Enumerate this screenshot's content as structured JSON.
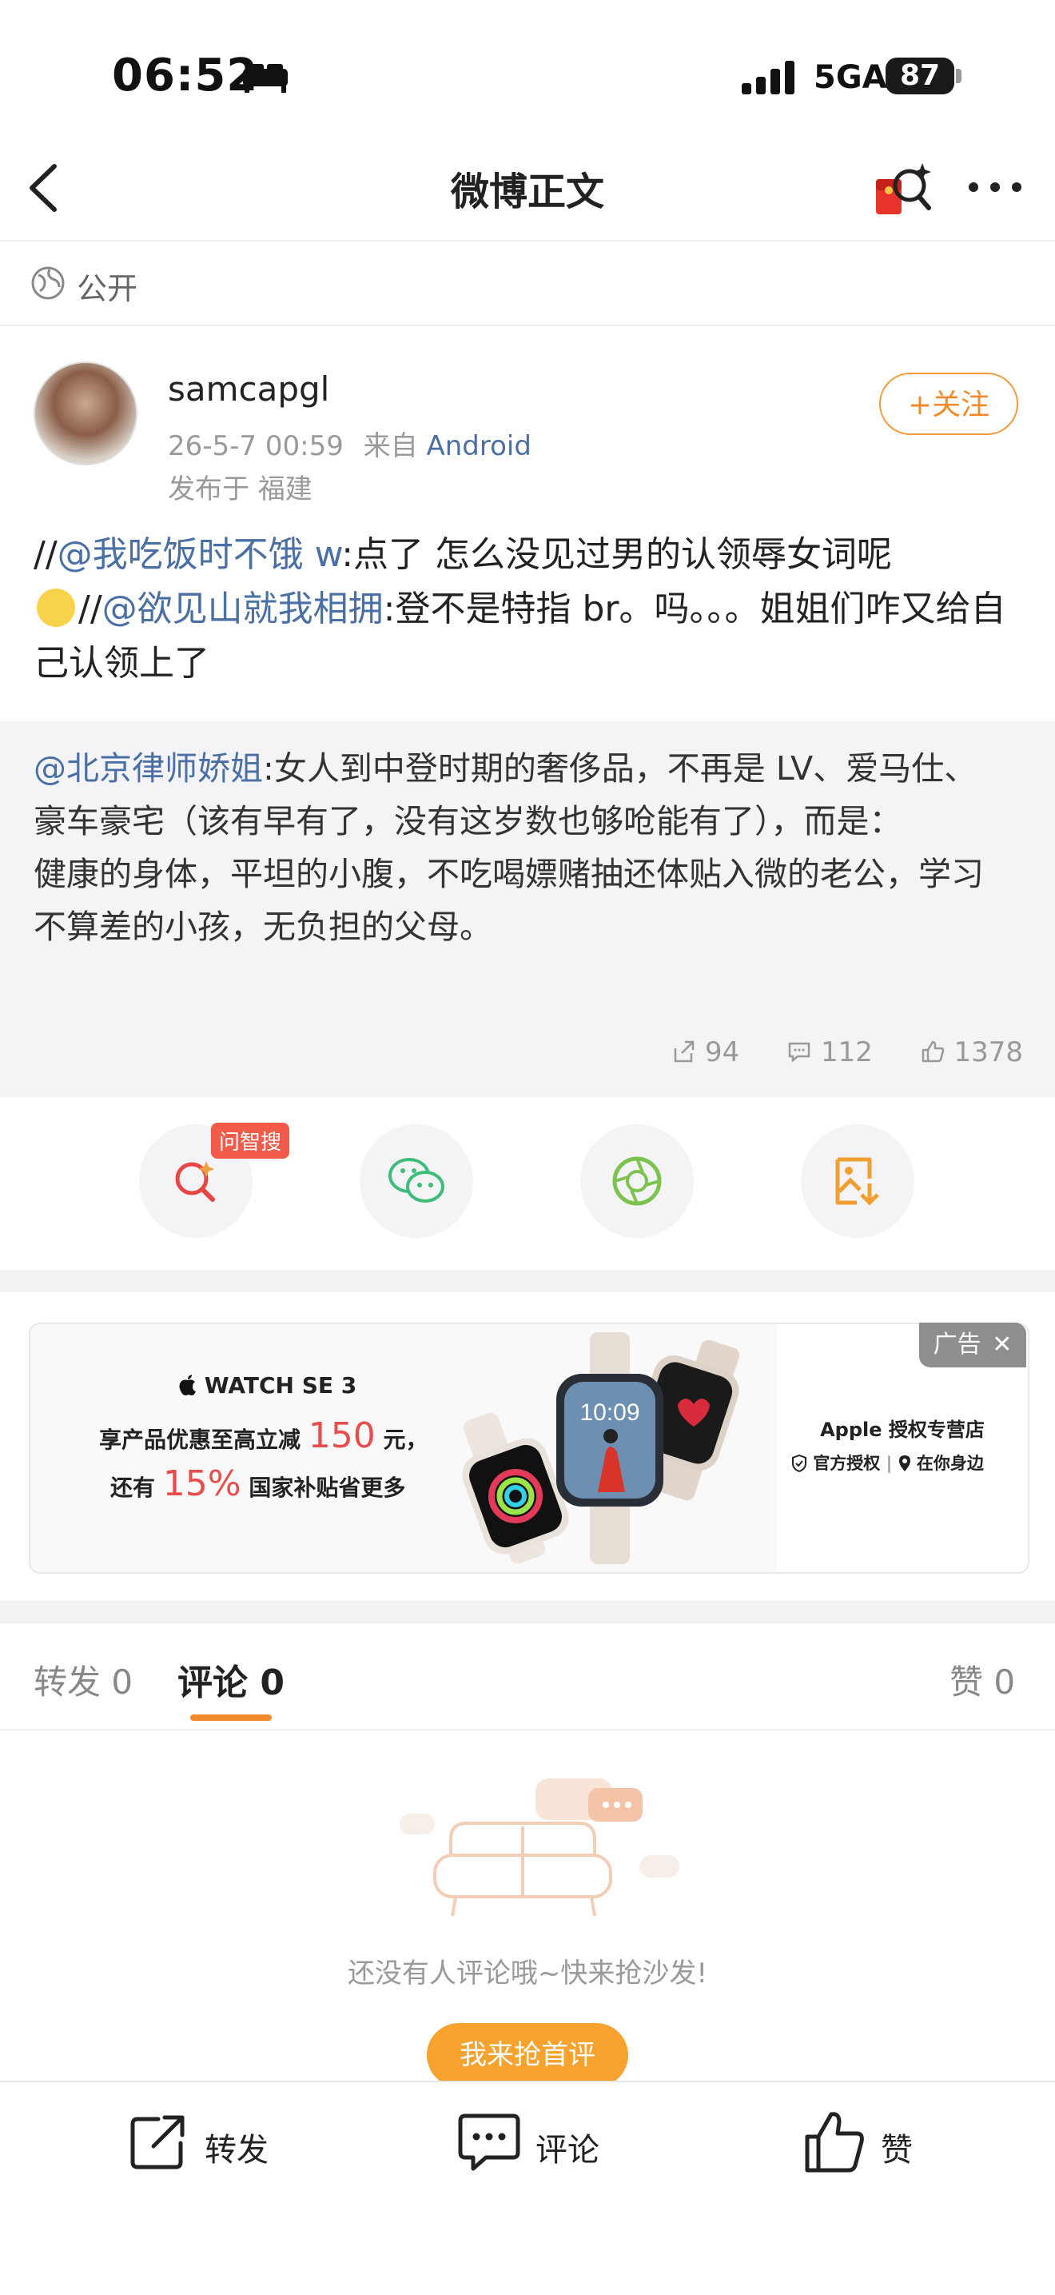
{
  "status": {
    "time": "06:52",
    "network": "5GA",
    "battery": "87"
  },
  "nav": {
    "title": "微博正文"
  },
  "visibility": {
    "label": "公开"
  },
  "author": {
    "name": "samcapgl",
    "datetime": "26-5-7 00:59",
    "source_prefix": "来自",
    "source": "Android",
    "location": "发布于 福建",
    "follow_label": "+关注"
  },
  "post": {
    "prefix1": "//",
    "mention1": "@我吃饭时不饿 w",
    "text1": ":点了 怎么没见过男的认领辱女词呢",
    "prefix2": "//",
    "mention2": "@欲见山就我相拥",
    "text2": ":登不是特指 br。吗。。。姐姐们咋又给自己认领上了"
  },
  "quote": {
    "mention": "@北京律师娇姐",
    "text": ":女人到中登时期的奢侈品，不再是 LV、爱马仕、豪车豪宅（该有早有了，没有这岁数也够呛能有了），而是：",
    "text2": "健康的身体，平坦的小腹，不吃喝嫖赌抽还体贴入微的老公，学习不算差的小孩，无负担的父母。",
    "reposts": "94",
    "comments": "112",
    "likes": "1378"
  },
  "actions": {
    "search_tag": "问智搜"
  },
  "ad": {
    "tag": "广告",
    "brand": "WATCH SE 3",
    "line1_a": "享产品优惠至高立减",
    "line1_num": "150",
    "line1_b": "元，",
    "line2_a": "还有",
    "line2_num": "15%",
    "line2_b": "国家补贴省更多",
    "watch_time": "10:09",
    "store": "Apple 授权专营店",
    "store_sub1": "官方授权",
    "store_sub2": "在你身边"
  },
  "tabs": {
    "repost": "转发 0",
    "comment": "评论 0",
    "like": "赞 0"
  },
  "empty": {
    "message": "还没有人评论哦~快来抢沙发!",
    "button": "我来抢首评"
  },
  "bottom": {
    "repost": "转发",
    "comment": "评论",
    "like": "赞"
  },
  "colors": {
    "accent": "#f08a2a",
    "link": "#4a6fa5",
    "tag": "#f25a4a"
  }
}
